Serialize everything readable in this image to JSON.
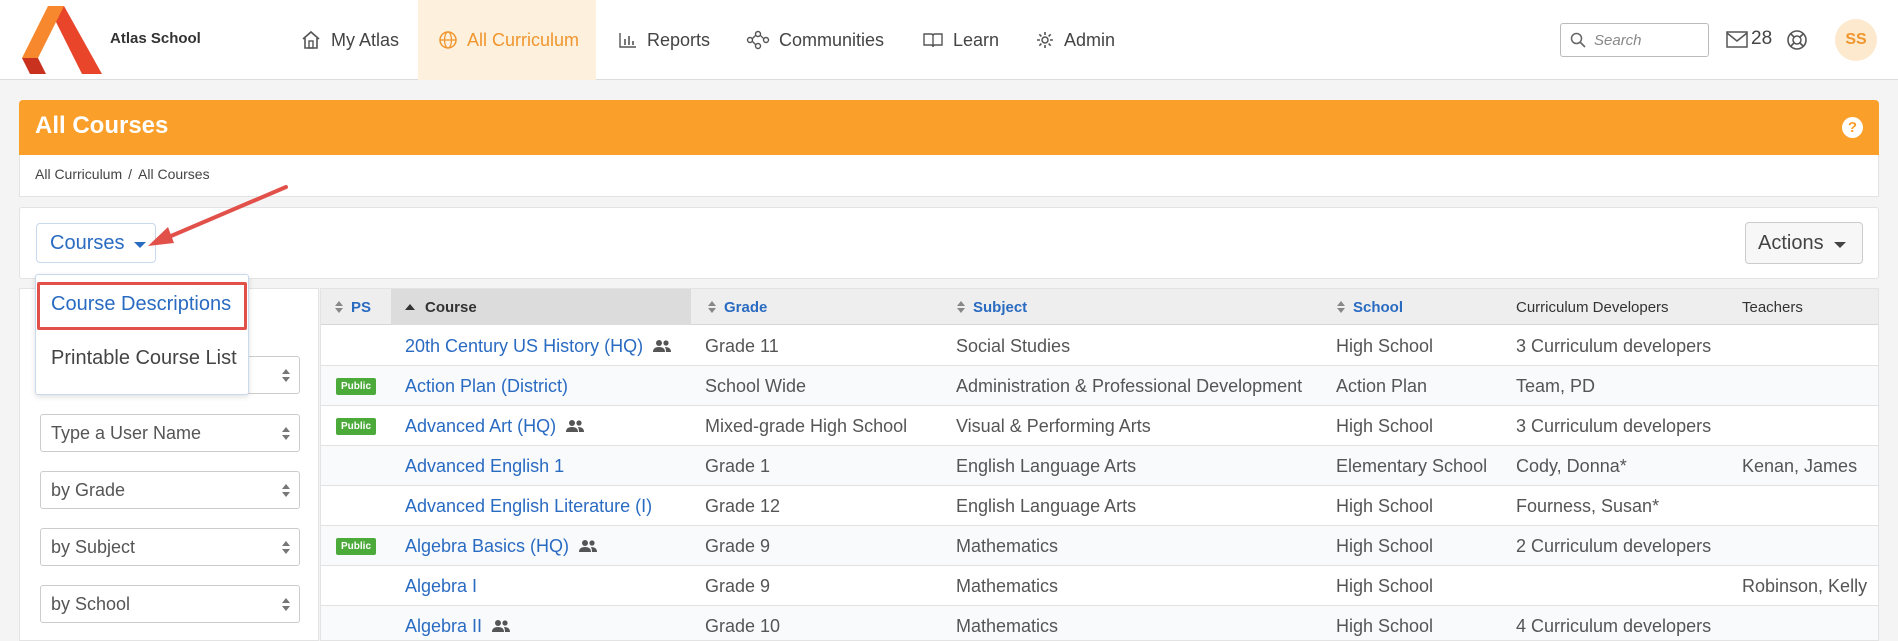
{
  "app": {
    "school_name": "Atlas School"
  },
  "nav": {
    "items": [
      {
        "label": "My Atlas",
        "icon": "home-icon"
      },
      {
        "label": "All Curriculum",
        "icon": "globe-icon",
        "active": true
      },
      {
        "label": "Reports",
        "icon": "bar-chart-icon"
      },
      {
        "label": "Communities",
        "icon": "network-icon"
      },
      {
        "label": "Learn",
        "icon": "book-icon"
      },
      {
        "label": "Admin",
        "icon": "gear-icon"
      }
    ],
    "search_placeholder": "Search",
    "mail_count": "28",
    "avatar_initials": "SS"
  },
  "colors": {
    "accent": "#f99f2a",
    "link": "#2a6bc2",
    "public_badge": "#4caa3a",
    "annotation": "#e2504a"
  },
  "page": {
    "title": "All Courses",
    "help": "?",
    "breadcrumb": [
      "All Curriculum",
      "/",
      "All Courses"
    ]
  },
  "toolbar": {
    "courses_label": "Courses",
    "actions_label": "Actions"
  },
  "dropdown": {
    "items": [
      "Course Descriptions",
      "Printable Course List"
    ]
  },
  "filters": [
    "Type a User Name",
    "by Grade",
    "by Subject",
    "by School"
  ],
  "table": {
    "headers": [
      "PS",
      "Course",
      "Grade",
      "Subject",
      "School",
      "Curriculum Developers",
      "Teachers"
    ],
    "rows": [
      {
        "badge": "",
        "course": "20th Century US History (HQ)",
        "community": true,
        "grade": "Grade 11",
        "subject": "Social Studies",
        "school": "High School",
        "developers": "3 Curriculum developers",
        "teachers": ""
      },
      {
        "badge": "Public",
        "course": "Action Plan (District)",
        "community": false,
        "grade": "School Wide",
        "subject": "Administration & Professional Development",
        "school": "Action Plan",
        "developers": "Team, PD",
        "teachers": ""
      },
      {
        "badge": "Public",
        "course": "Advanced Art (HQ)",
        "community": true,
        "grade": "Mixed-grade High School",
        "subject": "Visual & Performing Arts",
        "school": "High School",
        "developers": "3 Curriculum developers",
        "teachers": ""
      },
      {
        "badge": "",
        "course": "Advanced English 1",
        "community": false,
        "grade": "Grade 1",
        "subject": "English Language Arts",
        "school": "Elementary School",
        "developers": "Cody, Donna*",
        "teachers": "Kenan, James"
      },
      {
        "badge": "",
        "course": "Advanced English Literature (I)",
        "community": false,
        "grade": "Grade 12",
        "subject": "English Language Arts",
        "school": "High School",
        "developers": "Fourness, Susan*",
        "teachers": ""
      },
      {
        "badge": "Public",
        "course": "Algebra Basics (HQ)",
        "community": true,
        "grade": "Grade 9",
        "subject": "Mathematics",
        "school": "High School",
        "developers": "2 Curriculum developers",
        "teachers": ""
      },
      {
        "badge": "",
        "course": "Algebra I",
        "community": false,
        "grade": "Grade 9",
        "subject": "Mathematics",
        "school": "High School",
        "developers": "",
        "teachers": "Robinson, Kelly"
      },
      {
        "badge": "",
        "course": "Algebra II",
        "community": true,
        "grade": "Grade 10",
        "subject": "Mathematics",
        "school": "High School",
        "developers": "4 Curriculum developers",
        "teachers": ""
      }
    ]
  }
}
